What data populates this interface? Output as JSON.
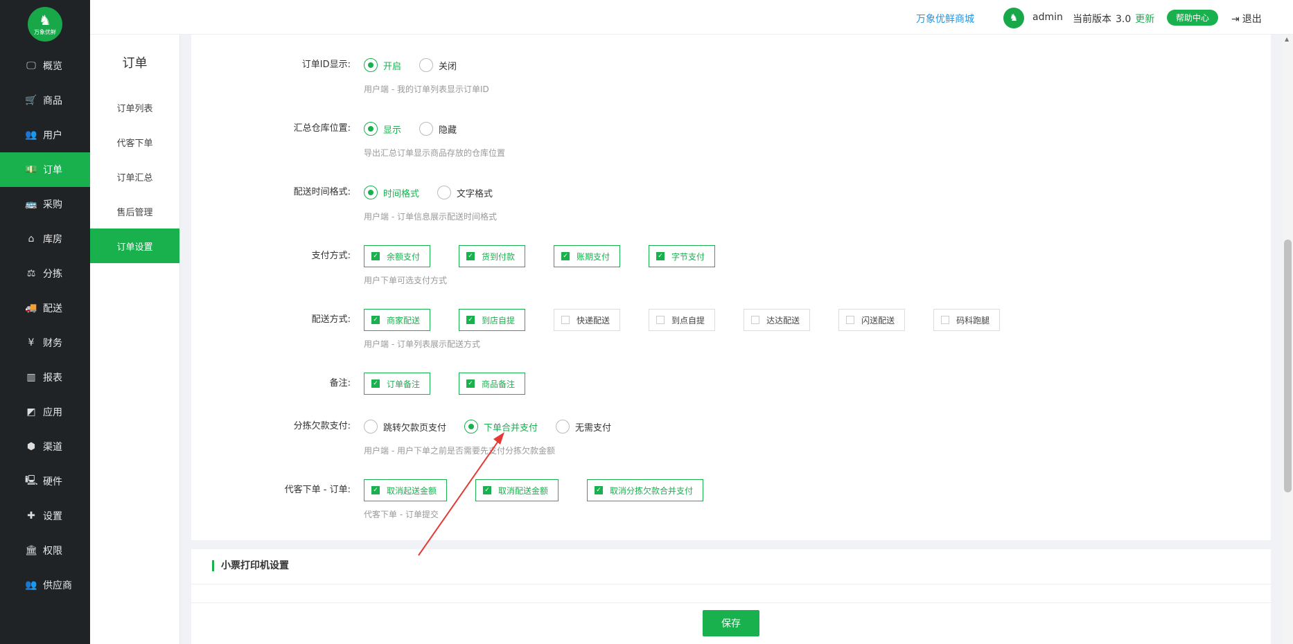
{
  "brand": {
    "logo_icon": "elephant-logo-icon",
    "logo_text": "万象优鲜"
  },
  "nav": {
    "items": [
      {
        "label": "概览",
        "icon": "monitor-icon",
        "glyph": "🖵",
        "active": false
      },
      {
        "label": "商品",
        "icon": "cart-icon",
        "glyph": "🛒",
        "active": false
      },
      {
        "label": "用户",
        "icon": "users-icon",
        "glyph": "👥",
        "active": false
      },
      {
        "label": "订单",
        "icon": "money-icon",
        "glyph": "💵",
        "active": true
      },
      {
        "label": "采购",
        "icon": "bus-icon",
        "glyph": "🚌",
        "active": false
      },
      {
        "label": "库房",
        "icon": "home-icon",
        "glyph": "⌂",
        "active": false
      },
      {
        "label": "分拣",
        "icon": "scale-icon",
        "glyph": "⚖",
        "active": false
      },
      {
        "label": "配送",
        "icon": "truck-icon",
        "glyph": "🚚",
        "active": false
      },
      {
        "label": "财务",
        "icon": "yen-icon",
        "glyph": "¥",
        "active": false
      },
      {
        "label": "报表",
        "icon": "bar-chart-icon",
        "glyph": "▥",
        "active": false
      },
      {
        "label": "应用",
        "icon": "apps-icon",
        "glyph": "◩",
        "active": false
      },
      {
        "label": "渠道",
        "icon": "cube-icon",
        "glyph": "⬢",
        "active": false
      },
      {
        "label": "硬件",
        "icon": "desktop-icon",
        "glyph": "🖳",
        "active": false
      },
      {
        "label": "设置",
        "icon": "puzzle-icon",
        "glyph": "✚",
        "active": false
      },
      {
        "label": "权限",
        "icon": "bank-icon",
        "glyph": "🏛",
        "active": false
      },
      {
        "label": "供应商",
        "icon": "group-icon",
        "glyph": "👥",
        "active": false
      }
    ]
  },
  "subnav": {
    "title": "订单",
    "items": [
      {
        "label": "订单列表",
        "active": false
      },
      {
        "label": "代客下单",
        "active": false
      },
      {
        "label": "订单汇总",
        "active": false
      },
      {
        "label": "售后管理",
        "active": false
      },
      {
        "label": "订单设置",
        "active": true
      }
    ]
  },
  "header": {
    "store_name": "万象优鲜商城",
    "user": "admin",
    "version_label": "当前版本",
    "version": "3.0",
    "update": "更新",
    "help": "帮助中心",
    "logout": "退出",
    "logout_glyph": "⇥"
  },
  "settings": {
    "order_id": {
      "label": "订单ID显示:",
      "options": [
        {
          "label": "开启",
          "on": true
        },
        {
          "label": "关闭",
          "on": false
        }
      ],
      "hint": "用户端 - 我的订单列表显示订单ID"
    },
    "warehouse": {
      "label": "汇总仓库位置:",
      "options": [
        {
          "label": "显示",
          "on": true
        },
        {
          "label": "隐藏",
          "on": false
        }
      ],
      "hint": "导出汇总订单显示商品存放的仓库位置"
    },
    "delivery_time": {
      "label": "配送时间格式:",
      "options": [
        {
          "label": "时间格式",
          "on": true
        },
        {
          "label": "文字格式",
          "on": false
        }
      ],
      "hint": "用户端 - 订单信息展示配送时间格式"
    },
    "payment": {
      "label": "支付方式:",
      "options": [
        {
          "label": "余额支付",
          "on": true
        },
        {
          "label": "货到付款",
          "on": true
        },
        {
          "label": "账期支付",
          "on": true
        },
        {
          "label": "字节支付",
          "on": true
        }
      ],
      "hint": "用户下单可选支付方式"
    },
    "delivery_method": {
      "label": "配送方式:",
      "options": [
        {
          "label": "商家配送",
          "on": true
        },
        {
          "label": "到店自提",
          "on": true
        },
        {
          "label": "快递配送",
          "on": false
        },
        {
          "label": "到点自提",
          "on": false
        },
        {
          "label": "达达配送",
          "on": false
        },
        {
          "label": "闪送配送",
          "on": false
        },
        {
          "label": "码科跑腿",
          "on": false
        }
      ],
      "hint": "用户端 - 订单列表展示配送方式"
    },
    "remarks": {
      "label": "备注:",
      "options": [
        {
          "label": "订单备注",
          "on": true
        },
        {
          "label": "商品备注",
          "on": true
        }
      ]
    },
    "sorting_debt": {
      "label": "分拣欠款支付:",
      "options": [
        {
          "label": "跳转欠款页支付",
          "on": false
        },
        {
          "label": "下单合并支付",
          "on": true
        },
        {
          "label": "无需支付",
          "on": false
        }
      ],
      "hint": "用户端 - 用户下单之前是否需要先支付分拣欠款金额"
    },
    "proxy_order": {
      "label": "代客下单 - 订单:",
      "options": [
        {
          "label": "取消起送金额",
          "on": true
        },
        {
          "label": "取消配送金额",
          "on": true
        },
        {
          "label": "取消分拣欠款合并支付",
          "on": true
        }
      ],
      "hint": "代客下单 - 订单提交"
    }
  },
  "printer_section": {
    "title": "小票打印机设置"
  },
  "footer": {
    "save": "保存"
  },
  "colors": {
    "accent": "#18b14e",
    "nav_bg": "#1f2326",
    "link": "#1e96e6",
    "arrow": "#e53935"
  }
}
